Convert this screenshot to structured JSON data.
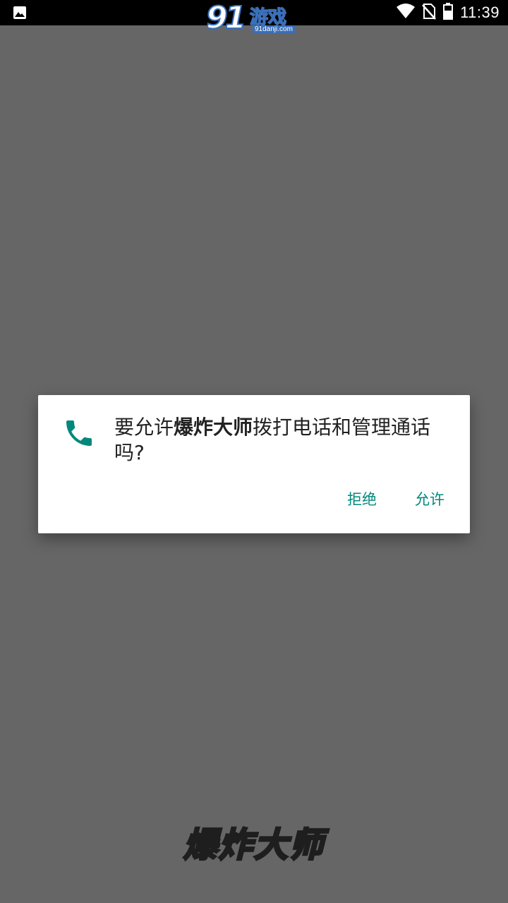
{
  "status_bar": {
    "time": "11:39",
    "left_icon": "image-notification-icon",
    "icons": [
      "wifi-icon",
      "no-sim-icon",
      "battery-icon"
    ]
  },
  "watermark": {
    "logo_number": "91",
    "logo_text": "游戏",
    "logo_url": "91danji.com"
  },
  "dialog": {
    "icon": "phone-icon",
    "message_prefix": "要允许",
    "app_name": "爆炸大师",
    "message_suffix": "拨打电话和管理通话吗?",
    "deny_label": "拒绝",
    "allow_label": "允许",
    "accent_color": "#00897b"
  },
  "background": {
    "game_title": "爆炸大师",
    "color": "#666666"
  }
}
